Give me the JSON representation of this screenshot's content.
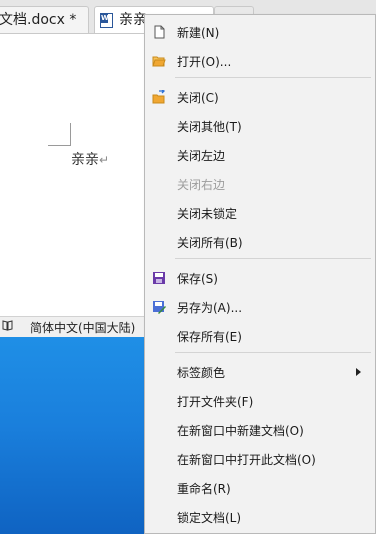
{
  "tabs": [
    {
      "label": "文档.docx *"
    },
    {
      "label": "亲亲"
    },
    {
      "label": ""
    }
  ],
  "document": {
    "text": "亲亲",
    "para_mark": "↵"
  },
  "statusbar": {
    "language": "简体中文(中国大陆)"
  },
  "menu": {
    "items": [
      {
        "label": "新建(N)",
        "icon": "new-document-icon"
      },
      {
        "label": "打开(O)...",
        "icon": "open-folder-icon"
      },
      {
        "label": "关闭(C)",
        "icon": "close-folder-icon"
      },
      {
        "label": "关闭其他(T)"
      },
      {
        "label": "关闭左边"
      },
      {
        "label": "关闭右边",
        "disabled": true
      },
      {
        "label": "关闭未锁定"
      },
      {
        "label": "关闭所有(B)"
      },
      {
        "label": "保存(S)",
        "icon": "save-icon"
      },
      {
        "label": "另存为(A)...",
        "icon": "save-as-icon"
      },
      {
        "label": "保存所有(E)"
      },
      {
        "label": "标签颜色",
        "submenu": true
      },
      {
        "label": "打开文件夹(F)"
      },
      {
        "label": "在新窗口中新建文档(O)"
      },
      {
        "label": "在新窗口中打开此文档(O)"
      },
      {
        "label": "重命名(R)"
      },
      {
        "label": "锁定文档(L)"
      }
    ]
  },
  "colors": {
    "save_icon": "#6a3aa8",
    "save_as_icon": "#4b6fd6",
    "folder_icon": "#f0a732",
    "desktop": "#1a7fdc"
  }
}
